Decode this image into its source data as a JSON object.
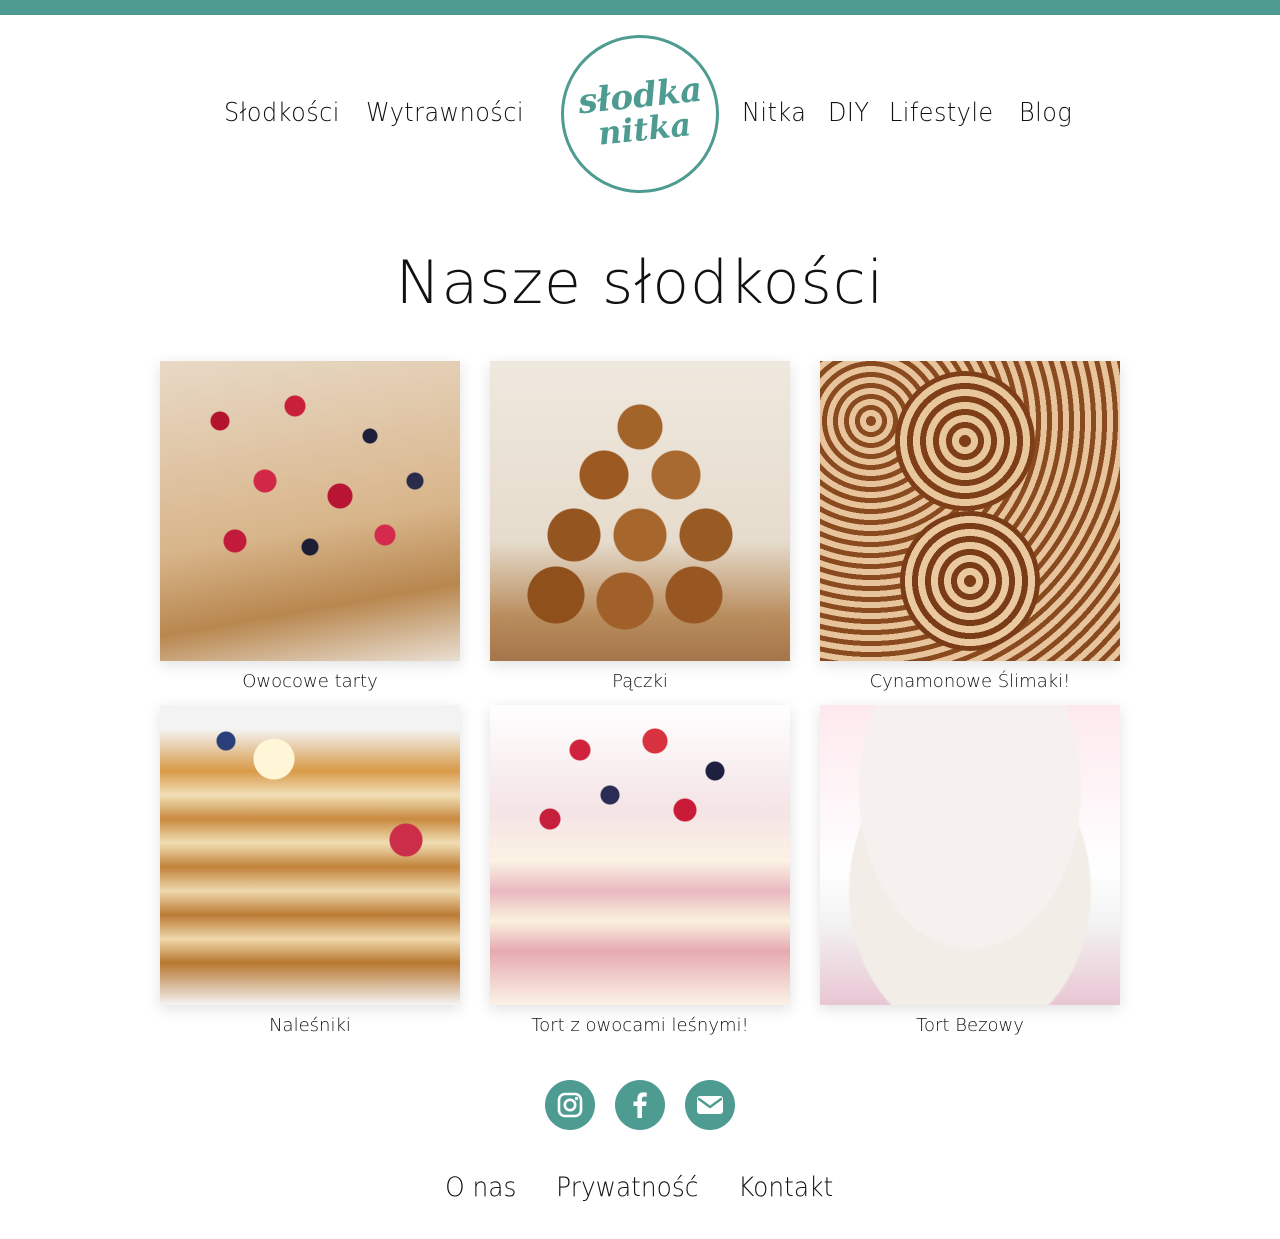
{
  "brand": {
    "logo_line1": "słodka",
    "logo_line2": "nitka",
    "accent_color": "#4e9b92"
  },
  "nav": {
    "left": [
      "Słodkości",
      "Wytrawności"
    ],
    "right": [
      "Nitka",
      "DIY",
      "Lifestyle",
      "Blog"
    ]
  },
  "main": {
    "title": "Nasze słodkości",
    "cards": [
      {
        "caption": "Owocowe tarty"
      },
      {
        "caption": "Pączki"
      },
      {
        "caption": "Cynamonowe Ślimaki!"
      },
      {
        "caption": "Naleśniki"
      },
      {
        "caption": "Tort z owocami leśnymi!"
      },
      {
        "caption": "Tort Bezowy"
      }
    ]
  },
  "social": {
    "icons": [
      "instagram-icon",
      "facebook-icon",
      "email-icon"
    ]
  },
  "footer": {
    "links": [
      "O nas",
      "Prywatność",
      "Kontakt"
    ]
  }
}
